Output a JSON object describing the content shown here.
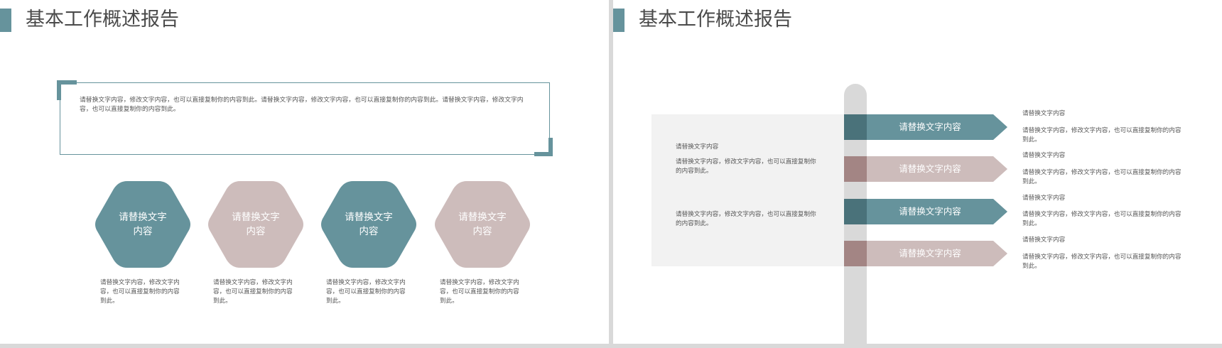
{
  "slide1": {
    "title": "基本工作概述报告",
    "frame_text": "请替换文字内容，修改文字内容，也可以直接复制你的内容到此。请替换文字内容，修改文字内容，也可以直接复制你的内容到此。请替换文字内容，修改文字内容，也可以直接复制你的内容到此。",
    "hexagons": [
      {
        "label": "请替换文字内容",
        "color": "#66939c",
        "description": "请替换文字内容，修改文字内容，也可以直接复制你的内容到此。"
      },
      {
        "label": "请替换文字内容",
        "color": "#cdbcbb",
        "description": "请替换文字内容，修改文字内容，也可以直接复制你的内容到此。"
      },
      {
        "label": "请替换文字内容",
        "color": "#66939c",
        "description": "请替换文字内容，修改文字内容，也可以直接复制你的内容到此。"
      },
      {
        "label": "请替换文字内容",
        "color": "#cdbcbb",
        "description": "请替换文字内容，修改文字内容，也可以直接复制你的内容到此。"
      }
    ]
  },
  "slide2": {
    "title": "基本工作概述报告",
    "panel": {
      "heading": "请替换文字内容",
      "paragraph_1": "请替换文字内容，修改文字内容，也可以直接复制你的内容到此。",
      "paragraph_2": "请替换文字内容，修改文字内容，也可以直接复制你的内容到此。"
    },
    "signs": [
      {
        "label": "请替换文字内容",
        "color": "#66939c",
        "dark_color": "#4a727a",
        "heading": "请替换文字内容",
        "text": "请替换文字内容，修改文字内容，也可以直接复制你的内容到此。"
      },
      {
        "label": "请替换文字内容",
        "color": "#cdbcbb",
        "dark_color": "#a38584",
        "heading": "请替换文字内容",
        "text": "请替换文字内容，修改文字内容，也可以直接复制你的内容到此。"
      },
      {
        "label": "请替换文字内容",
        "color": "#66939c",
        "dark_color": "#4a727a",
        "heading": "请替换文字内容",
        "text": "请替换文字内容，修改文字内容，也可以直接复制你的内容到此。"
      },
      {
        "label": "请替换文字内容",
        "color": "#cdbcbb",
        "dark_color": "#a38584",
        "heading": "请替换文字内容",
        "text": "请替换文字内容，修改文字内容，也可以直接复制你的内容到此。"
      }
    ]
  }
}
